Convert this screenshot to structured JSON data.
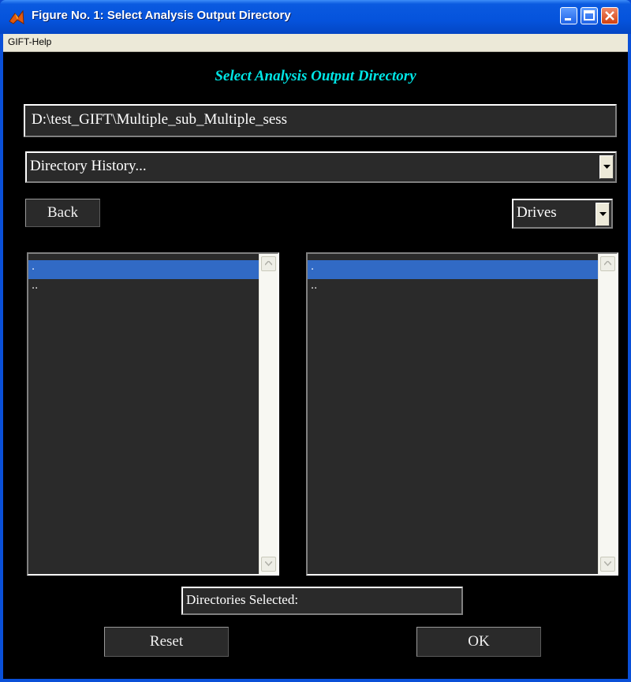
{
  "window": {
    "title": "Figure No. 1: Select Analysis Output Directory"
  },
  "menu": {
    "items": [
      "GIFT-Help"
    ]
  },
  "heading": "Select Analysis Output Directory",
  "path_field": {
    "value": "D:\\test_GIFT\\Multiple_sub_Multiple_sess"
  },
  "history": {
    "selected": "Directory History..."
  },
  "back_button": "Back",
  "drives": {
    "selected": "Drives"
  },
  "left_list": {
    "items": [
      ".",
      ".."
    ],
    "selected_index": 0
  },
  "right_list": {
    "items": [
      ".",
      ".."
    ],
    "selected_index": 0
  },
  "status_text": "Directories Selected:",
  "reset_button": "Reset",
  "ok_button": "OK",
  "colors": {
    "heading": "#00e6e6",
    "selection": "#316ac5",
    "field_bg": "#2a2a2a",
    "titlebar": "#0553dc"
  }
}
